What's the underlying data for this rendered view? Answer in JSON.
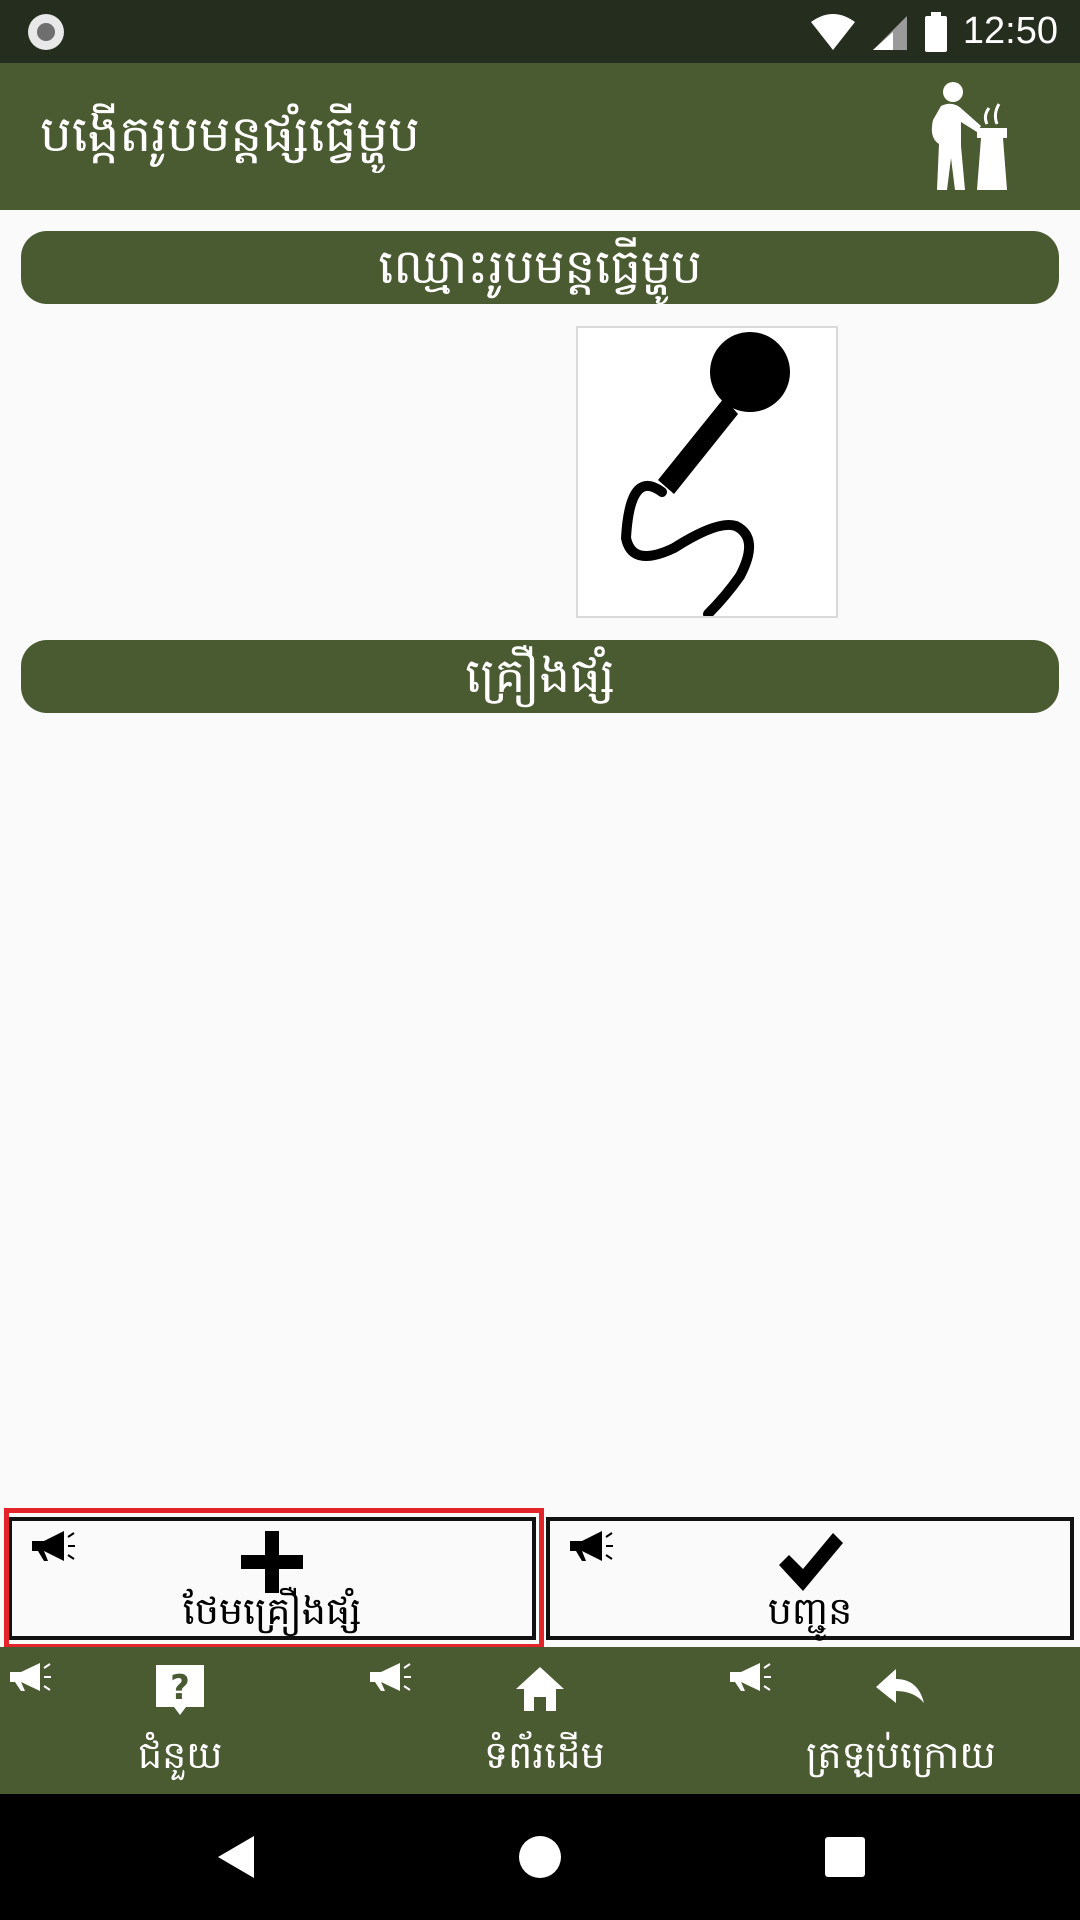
{
  "status_bar": {
    "time": "12:50"
  },
  "app_bar": {
    "title": "បង្កើតរូបមន្តផ្សំធ្វើម្ហូប",
    "icon": "chef-cooking-icon"
  },
  "recipe": {
    "name_placeholder": "ឈ្មោះរូបមន្តធ្វើម្ហូប",
    "image_icon": "microphone-icon",
    "ingredients_header": "គ្រឿងផ្សំ",
    "ingredients": []
  },
  "actions": {
    "add_ingredient": {
      "label": "ថែមគ្រឿងផ្សំ",
      "icon": "plus-icon",
      "highlighted": true
    },
    "submit": {
      "label": "បញ្ជូន",
      "icon": "checkmark-icon"
    }
  },
  "bottom_nav": {
    "items": [
      {
        "label": "ជំនួយ",
        "icon": "help-icon"
      },
      {
        "label": "ទំព័រដើម",
        "icon": "home-icon"
      },
      {
        "label": "ត្រឡប់ក្រោយ",
        "icon": "back-icon"
      }
    ]
  },
  "colors": {
    "primary": "#4a5b32",
    "highlight": "#e3242b",
    "status_bar": "#252d1f"
  }
}
